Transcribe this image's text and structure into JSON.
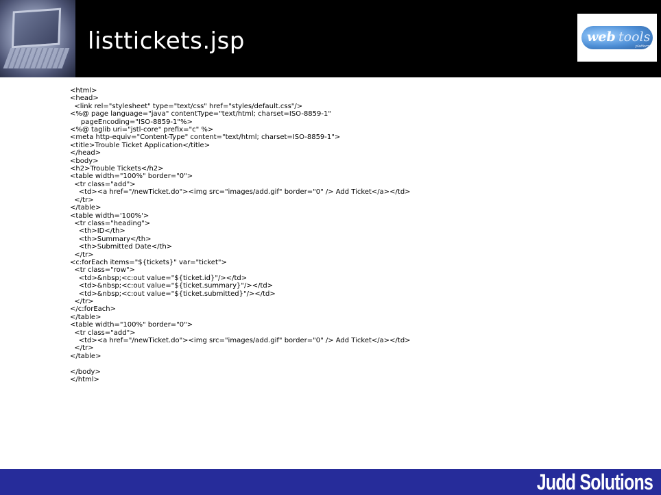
{
  "slide": {
    "title": "listtickets.jsp",
    "logo_text_web": "web",
    "logo_text_tools": "tools",
    "logo_subtext": "platform",
    "footer_brand": "Judd Solutions"
  },
  "code_lines": [
    "<html>",
    "<head>",
    "  <link rel=\"stylesheet\" type=\"text/css\" href=\"styles/default.css\"/>",
    "<%@ page language=\"java\" contentType=\"text/html; charset=ISO-8859-1\"",
    "     pageEncoding=\"ISO-8859-1\"%>",
    "<%@ taglib uri=\"jstl-core\" prefix=\"c\" %>",
    "<meta http-equiv=\"Content-Type\" content=\"text/html; charset=ISO-8859-1\">",
    "<title>Trouble Ticket Application</title>",
    "</head>",
    "<body>",
    "<h2>Trouble Tickets</h2>",
    "<table width=\"100%\" border=\"0\">",
    "  <tr class=\"add\">",
    "    <td><a href=\"/newTicket.do\"><img src=\"images/add.gif\" border=\"0\" /> Add Ticket</a></td>",
    "  </tr>",
    "</table>",
    "<table width='100%'>",
    "  <tr class=\"heading\">",
    "    <th>ID</th>",
    "    <th>Summary</th>",
    "    <th>Submitted Date</th>",
    "  </tr>",
    "<c:forEach items=\"${tickets}\" var=\"ticket\">",
    "  <tr class=\"row\">",
    "    <td>&nbsp;<c:out value=\"${ticket.id}\"/></td>",
    "    <td>&nbsp;<c:out value=\"${ticket.summary}\"/></td>",
    "    <td>&nbsp;<c:out value=\"${ticket.submitted}\"/></td>",
    "  </tr>",
    "</c:forEach>",
    "</table>",
    "<table width=\"100%\" border=\"0\">",
    "  <tr class=\"add\">",
    "    <td><a href=\"/newTicket.do\"><img src=\"images/add.gif\" border=\"0\" /> Add Ticket</a></td>",
    "  </tr>",
    "</table>",
    "",
    "</body>",
    "</html>"
  ]
}
